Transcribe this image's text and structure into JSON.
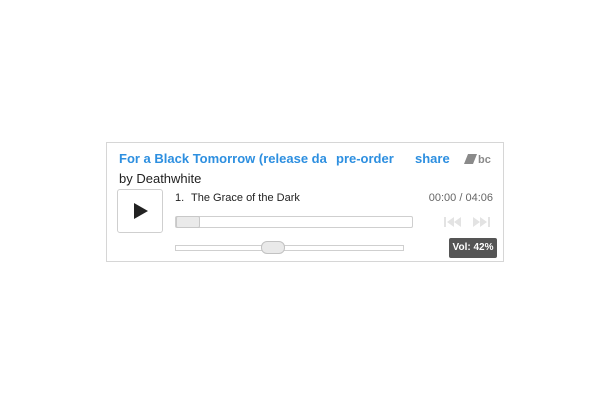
{
  "player": {
    "album_title": "For a Black Tomorrow (release date...",
    "preorder_label": "pre-order",
    "share_label": "share",
    "logo_icon": "bandcamp-logo",
    "artist_line": "by Deathwhite",
    "play_icon": "play-icon",
    "track": {
      "number": "1.",
      "title": "The Grace of the Dark"
    },
    "time_current": "00:00",
    "time_separator": " / ",
    "time_total": "04:06",
    "progress_fraction": 0.0,
    "prev_icon": "previous-track-icon",
    "next_icon": "next-track-icon",
    "volume_percent": 42,
    "volume_label": "Vol: 42%",
    "link_color": "#2d8fe0"
  }
}
